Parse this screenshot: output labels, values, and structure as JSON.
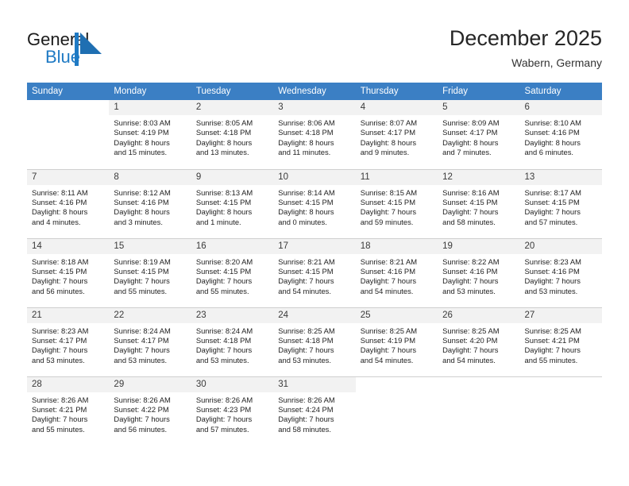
{
  "brand": {
    "name_part1": "General",
    "name_part2": "Blue",
    "mark_icon": "blue-triangle-flag-icon",
    "color_primary": "#1f7ac4",
    "color_text": "#1b1b1b"
  },
  "header": {
    "title": "December 2025",
    "location": "Wabern, Germany"
  },
  "calendar": {
    "header_bg": "#3b7fc4",
    "daynum_bg": "#f2f2f2",
    "weekday_headers": [
      "Sunday",
      "Monday",
      "Tuesday",
      "Wednesday",
      "Thursday",
      "Friday",
      "Saturday"
    ],
    "weeks": [
      [
        {
          "day": "",
          "sunrise": "",
          "sunset": "",
          "daylight_line1": "",
          "daylight_line2": ""
        },
        {
          "day": "1",
          "sunrise": "Sunrise: 8:03 AM",
          "sunset": "Sunset: 4:19 PM",
          "daylight_line1": "Daylight: 8 hours",
          "daylight_line2": "and 15 minutes."
        },
        {
          "day": "2",
          "sunrise": "Sunrise: 8:05 AM",
          "sunset": "Sunset: 4:18 PM",
          "daylight_line1": "Daylight: 8 hours",
          "daylight_line2": "and 13 minutes."
        },
        {
          "day": "3",
          "sunrise": "Sunrise: 8:06 AM",
          "sunset": "Sunset: 4:18 PM",
          "daylight_line1": "Daylight: 8 hours",
          "daylight_line2": "and 11 minutes."
        },
        {
          "day": "4",
          "sunrise": "Sunrise: 8:07 AM",
          "sunset": "Sunset: 4:17 PM",
          "daylight_line1": "Daylight: 8 hours",
          "daylight_line2": "and 9 minutes."
        },
        {
          "day": "5",
          "sunrise": "Sunrise: 8:09 AM",
          "sunset": "Sunset: 4:17 PM",
          "daylight_line1": "Daylight: 8 hours",
          "daylight_line2": "and 7 minutes."
        },
        {
          "day": "6",
          "sunrise": "Sunrise: 8:10 AM",
          "sunset": "Sunset: 4:16 PM",
          "daylight_line1": "Daylight: 8 hours",
          "daylight_line2": "and 6 minutes."
        }
      ],
      [
        {
          "day": "7",
          "sunrise": "Sunrise: 8:11 AM",
          "sunset": "Sunset: 4:16 PM",
          "daylight_line1": "Daylight: 8 hours",
          "daylight_line2": "and 4 minutes."
        },
        {
          "day": "8",
          "sunrise": "Sunrise: 8:12 AM",
          "sunset": "Sunset: 4:16 PM",
          "daylight_line1": "Daylight: 8 hours",
          "daylight_line2": "and 3 minutes."
        },
        {
          "day": "9",
          "sunrise": "Sunrise: 8:13 AM",
          "sunset": "Sunset: 4:15 PM",
          "daylight_line1": "Daylight: 8 hours",
          "daylight_line2": "and 1 minute."
        },
        {
          "day": "10",
          "sunrise": "Sunrise: 8:14 AM",
          "sunset": "Sunset: 4:15 PM",
          "daylight_line1": "Daylight: 8 hours",
          "daylight_line2": "and 0 minutes."
        },
        {
          "day": "11",
          "sunrise": "Sunrise: 8:15 AM",
          "sunset": "Sunset: 4:15 PM",
          "daylight_line1": "Daylight: 7 hours",
          "daylight_line2": "and 59 minutes."
        },
        {
          "day": "12",
          "sunrise": "Sunrise: 8:16 AM",
          "sunset": "Sunset: 4:15 PM",
          "daylight_line1": "Daylight: 7 hours",
          "daylight_line2": "and 58 minutes."
        },
        {
          "day": "13",
          "sunrise": "Sunrise: 8:17 AM",
          "sunset": "Sunset: 4:15 PM",
          "daylight_line1": "Daylight: 7 hours",
          "daylight_line2": "and 57 minutes."
        }
      ],
      [
        {
          "day": "14",
          "sunrise": "Sunrise: 8:18 AM",
          "sunset": "Sunset: 4:15 PM",
          "daylight_line1": "Daylight: 7 hours",
          "daylight_line2": "and 56 minutes."
        },
        {
          "day": "15",
          "sunrise": "Sunrise: 8:19 AM",
          "sunset": "Sunset: 4:15 PM",
          "daylight_line1": "Daylight: 7 hours",
          "daylight_line2": "and 55 minutes."
        },
        {
          "day": "16",
          "sunrise": "Sunrise: 8:20 AM",
          "sunset": "Sunset: 4:15 PM",
          "daylight_line1": "Daylight: 7 hours",
          "daylight_line2": "and 55 minutes."
        },
        {
          "day": "17",
          "sunrise": "Sunrise: 8:21 AM",
          "sunset": "Sunset: 4:15 PM",
          "daylight_line1": "Daylight: 7 hours",
          "daylight_line2": "and 54 minutes."
        },
        {
          "day": "18",
          "sunrise": "Sunrise: 8:21 AM",
          "sunset": "Sunset: 4:16 PM",
          "daylight_line1": "Daylight: 7 hours",
          "daylight_line2": "and 54 minutes."
        },
        {
          "day": "19",
          "sunrise": "Sunrise: 8:22 AM",
          "sunset": "Sunset: 4:16 PM",
          "daylight_line1": "Daylight: 7 hours",
          "daylight_line2": "and 53 minutes."
        },
        {
          "day": "20",
          "sunrise": "Sunrise: 8:23 AM",
          "sunset": "Sunset: 4:16 PM",
          "daylight_line1": "Daylight: 7 hours",
          "daylight_line2": "and 53 minutes."
        }
      ],
      [
        {
          "day": "21",
          "sunrise": "Sunrise: 8:23 AM",
          "sunset": "Sunset: 4:17 PM",
          "daylight_line1": "Daylight: 7 hours",
          "daylight_line2": "and 53 minutes."
        },
        {
          "day": "22",
          "sunrise": "Sunrise: 8:24 AM",
          "sunset": "Sunset: 4:17 PM",
          "daylight_line1": "Daylight: 7 hours",
          "daylight_line2": "and 53 minutes."
        },
        {
          "day": "23",
          "sunrise": "Sunrise: 8:24 AM",
          "sunset": "Sunset: 4:18 PM",
          "daylight_line1": "Daylight: 7 hours",
          "daylight_line2": "and 53 minutes."
        },
        {
          "day": "24",
          "sunrise": "Sunrise: 8:25 AM",
          "sunset": "Sunset: 4:18 PM",
          "daylight_line1": "Daylight: 7 hours",
          "daylight_line2": "and 53 minutes."
        },
        {
          "day": "25",
          "sunrise": "Sunrise: 8:25 AM",
          "sunset": "Sunset: 4:19 PM",
          "daylight_line1": "Daylight: 7 hours",
          "daylight_line2": "and 54 minutes."
        },
        {
          "day": "26",
          "sunrise": "Sunrise: 8:25 AM",
          "sunset": "Sunset: 4:20 PM",
          "daylight_line1": "Daylight: 7 hours",
          "daylight_line2": "and 54 minutes."
        },
        {
          "day": "27",
          "sunrise": "Sunrise: 8:25 AM",
          "sunset": "Sunset: 4:21 PM",
          "daylight_line1": "Daylight: 7 hours",
          "daylight_line2": "and 55 minutes."
        }
      ],
      [
        {
          "day": "28",
          "sunrise": "Sunrise: 8:26 AM",
          "sunset": "Sunset: 4:21 PM",
          "daylight_line1": "Daylight: 7 hours",
          "daylight_line2": "and 55 minutes."
        },
        {
          "day": "29",
          "sunrise": "Sunrise: 8:26 AM",
          "sunset": "Sunset: 4:22 PM",
          "daylight_line1": "Daylight: 7 hours",
          "daylight_line2": "and 56 minutes."
        },
        {
          "day": "30",
          "sunrise": "Sunrise: 8:26 AM",
          "sunset": "Sunset: 4:23 PM",
          "daylight_line1": "Daylight: 7 hours",
          "daylight_line2": "and 57 minutes."
        },
        {
          "day": "31",
          "sunrise": "Sunrise: 8:26 AM",
          "sunset": "Sunset: 4:24 PM",
          "daylight_line1": "Daylight: 7 hours",
          "daylight_line2": "and 58 minutes."
        },
        {
          "day": "",
          "sunrise": "",
          "sunset": "",
          "daylight_line1": "",
          "daylight_line2": ""
        },
        {
          "day": "",
          "sunrise": "",
          "sunset": "",
          "daylight_line1": "",
          "daylight_line2": ""
        },
        {
          "day": "",
          "sunrise": "",
          "sunset": "",
          "daylight_line1": "",
          "daylight_line2": ""
        }
      ]
    ]
  }
}
